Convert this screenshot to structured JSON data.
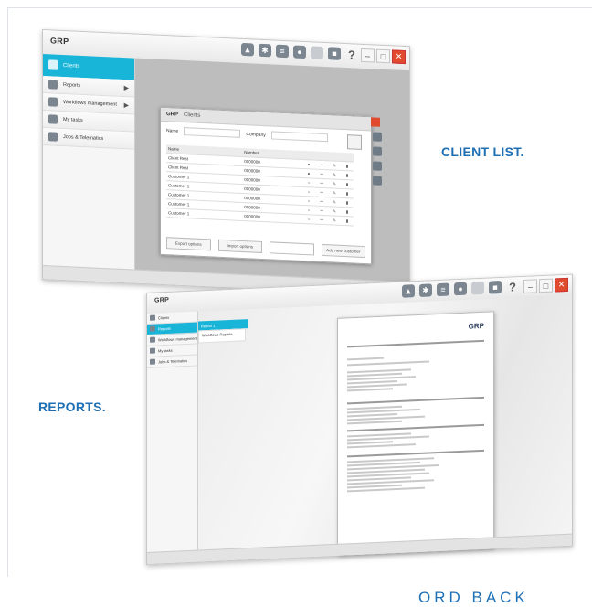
{
  "labels": {
    "client_list": "CLIENT LIST.",
    "reports": "REPORTS.",
    "footer": "ORD BACK"
  },
  "window1": {
    "logo": "GRP",
    "sidebar": [
      "Clients",
      "Reports",
      "Workflows management",
      "My tasks",
      "Jobs & Telematics"
    ],
    "dialog": {
      "title_logo": "GRP",
      "title": "Clients",
      "field_label": "Name",
      "field_label2": "Company",
      "columns": [
        "Name",
        "Number"
      ],
      "rows": [
        [
          "Client Rest",
          "0000000"
        ],
        [
          "Client Rest",
          "0000000"
        ],
        [
          "Customer 1",
          "0000000"
        ],
        [
          "Customer 1",
          "0000000"
        ],
        [
          "Customer 1",
          "0000000"
        ],
        [
          "Customer 1",
          "0000000"
        ],
        [
          "Customer 1",
          "0000000"
        ]
      ],
      "buttons": [
        "Export options",
        "Import options",
        "",
        "Add new customer"
      ]
    }
  },
  "window2": {
    "logo": "GRP",
    "sidebar": [
      "Clients",
      "Reports",
      "Workflows management",
      "My tasks",
      "Jobs & Telematics"
    ],
    "submenu": [
      "Report 1",
      "Workflows Reports"
    ],
    "document_logo": "GRP"
  },
  "icons": {
    "toolbar": [
      "bell-icon",
      "gear-icon",
      "list-icon",
      "user-icon",
      "dot-icon",
      "chat-icon",
      "help-icon"
    ]
  },
  "colors": {
    "accent": "#19b5d8",
    "label_blue": "#1f6fb5",
    "close_red": "#e04a2f"
  }
}
